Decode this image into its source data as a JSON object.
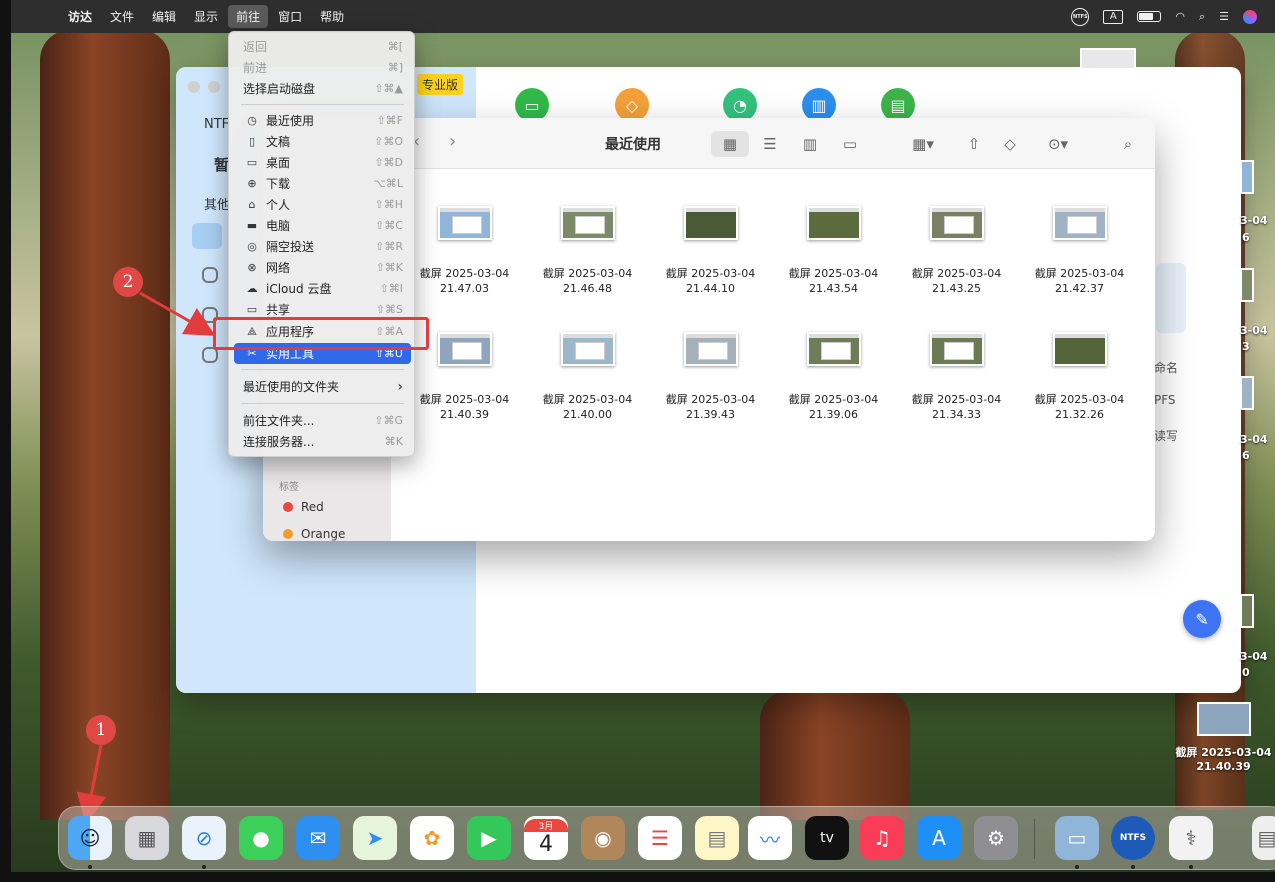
{
  "menubar": {
    "items": [
      "访达",
      "文件",
      "编辑",
      "显示",
      "前往",
      "窗口",
      "帮助"
    ],
    "active": "前往",
    "status": {
      "ntfs": "NTFS",
      "input": "A"
    }
  },
  "go_menu": {
    "items": [
      {
        "label": "返回",
        "shortcut": "⌘[",
        "icon": "",
        "disabled": true
      },
      {
        "label": "前进",
        "shortcut": "⌘]",
        "icon": "",
        "disabled": true
      },
      {
        "label": "选择启动磁盘",
        "shortcut": "⇧⌘▲",
        "icon": ""
      },
      {
        "label": "最近使用",
        "shortcut": "⇧⌘F",
        "icon": "clock-icon"
      },
      {
        "label": "文稿",
        "shortcut": "⇧⌘O",
        "icon": "document-icon"
      },
      {
        "label": "桌面",
        "shortcut": "⇧⌘D",
        "icon": "desktop-icon"
      },
      {
        "label": "下载",
        "shortcut": "⌥⌘L",
        "icon": "download-icon"
      },
      {
        "label": "个人",
        "shortcut": "⇧⌘H",
        "icon": "home-icon"
      },
      {
        "label": "电脑",
        "shortcut": "⇧⌘C",
        "icon": "laptop-icon"
      },
      {
        "label": "隔空投送",
        "shortcut": "⇧⌘R",
        "icon": "airdrop-icon"
      },
      {
        "label": "网络",
        "shortcut": "⇧⌘K",
        "icon": "globe-icon"
      },
      {
        "label": "iCloud 云盘",
        "shortcut": "⇧⌘I",
        "icon": "cloud-icon"
      },
      {
        "label": "共享",
        "shortcut": "⇧⌘S",
        "icon": "shared-folder-icon"
      },
      {
        "label": "应用程序",
        "shortcut": "⇧⌘A",
        "icon": "apps-icon"
      },
      {
        "label": "实用工具",
        "shortcut": "⇧⌘U",
        "icon": "tools-icon",
        "highlighted": true
      },
      {
        "label": "最近使用的文件夹",
        "shortcut": "›",
        "icon": ""
      },
      {
        "label": "前往文件夹...",
        "shortcut": "⇧⌘G",
        "icon": ""
      },
      {
        "label": "连接服务器...",
        "shortcut": "⌘K",
        "icon": ""
      }
    ]
  },
  "ntfs_app": {
    "sidebar_labels": [
      "NTF",
      "暂",
      "其他"
    ],
    "pro_badge": "专业版",
    "right_fragments": [
      "命名",
      "PFS",
      "读写"
    ]
  },
  "finder": {
    "title": "最近使用",
    "tags_header": "标签",
    "tags": [
      {
        "name": "Red",
        "color": "#e8483f"
      },
      {
        "name": "Orange",
        "color": "#f39a2b"
      }
    ],
    "files": [
      {
        "line1": "截屏 2025-03-04",
        "line2": "21.47.03",
        "thumb": "#8fb6d8"
      },
      {
        "line1": "截屏 2025-03-04",
        "line2": "21.46.48",
        "thumb": "#7d8a6a"
      },
      {
        "line1": "截屏 2025-03-04",
        "line2": "21.44.10",
        "thumb": "#4a5a36"
      },
      {
        "line1": "截屏 2025-03-04",
        "line2": "21.43.54",
        "thumb": "#5b6b3e"
      },
      {
        "line1": "截屏 2025-03-04",
        "line2": "21.43.25",
        "thumb": "#7a7f66"
      },
      {
        "line1": "截屏 2025-03-04",
        "line2": "21.42.37",
        "thumb": "#9fb3c4"
      },
      {
        "line1": "截屏 2025-03-04",
        "line2": "21.40.39",
        "thumb": "#8ea6bd"
      },
      {
        "line1": "截屏 2025-03-04",
        "line2": "21.40.00",
        "thumb": "#9cb7c9"
      },
      {
        "line1": "截屏 2025-03-04",
        "line2": "21.39.43",
        "thumb": "#a6b0b8"
      },
      {
        "line1": "截屏 2025-03-04",
        "line2": "21.39.06",
        "thumb": "#6e7d58"
      },
      {
        "line1": "截屏 2025-03-04",
        "line2": "21.34.33",
        "thumb": "#6b7a52"
      },
      {
        "line1": "截屏 2025-03-04",
        "line2": "21.32.26",
        "thumb": "#55653a"
      }
    ]
  },
  "desktop": {
    "files_right": [
      {
        "line1": "截屏 2025-03-04",
        "line2": "21.40.39"
      }
    ],
    "fragments": [
      "3-04",
      "6",
      "3-04",
      "3",
      "3-04",
      "6",
      "3-04",
      "0"
    ]
  },
  "annotations": {
    "step1": "1",
    "step2": "2",
    "accent": "#e23c3c"
  },
  "dock": {
    "calendar_month": "3月",
    "calendar_day": "4",
    "tv_label": "tv",
    "ntfs_label": "NTFS"
  }
}
